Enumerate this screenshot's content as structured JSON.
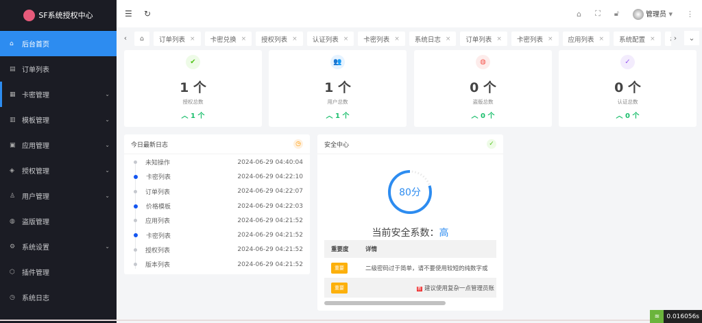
{
  "app": {
    "title": "SF系统授权中心"
  },
  "sidebar": {
    "items": [
      {
        "label": "后台首页",
        "icon": "home-icon",
        "glyph": "⌂",
        "active": true
      },
      {
        "label": "订单列表",
        "icon": "document-icon",
        "glyph": "▤"
      },
      {
        "label": "卡密管理",
        "icon": "grid-icon",
        "glyph": "▦",
        "expandable": true,
        "open": true
      },
      {
        "label": "模板管理",
        "icon": "template-icon",
        "glyph": "▥",
        "expandable": true
      },
      {
        "label": "应用管理",
        "icon": "app-icon",
        "glyph": "▣",
        "expandable": true
      },
      {
        "label": "授权管理",
        "icon": "shield-icon",
        "glyph": "◈",
        "expandable": true
      },
      {
        "label": "用户管理",
        "icon": "user-icon",
        "glyph": "♙",
        "expandable": true
      },
      {
        "label": "盗版管理",
        "icon": "globe-icon",
        "glyph": "◍"
      },
      {
        "label": "系统设置",
        "icon": "gear-icon",
        "glyph": "⚙",
        "expandable": true
      },
      {
        "label": "插件管理",
        "icon": "plugin-icon",
        "glyph": "⬡"
      },
      {
        "label": "系统日志",
        "icon": "clock-icon",
        "glyph": "◷"
      }
    ]
  },
  "header": {
    "user": "管理员"
  },
  "tabs": [
    "订单列表",
    "卡密兑换",
    "授权列表",
    "认证列表",
    "卡密列表",
    "系统日志",
    "订单列表",
    "卡密列表",
    "应用列表",
    "系统配置",
    "模板"
  ],
  "stats": [
    {
      "value": "1 个",
      "label": "授权总数",
      "increase": "1 个",
      "icon": "shield-check-icon",
      "color": "#52c41a",
      "bg": "#eefbe7",
      "glyph": "✔"
    },
    {
      "value": "1 个",
      "label": "用户总数",
      "increase": "1 个",
      "icon": "users-icon",
      "color": "#2d8cf0",
      "bg": "#e6f3ff",
      "glyph": "👥"
    },
    {
      "value": "0 个",
      "label": "盗版总数",
      "increase": "0 个",
      "icon": "globe-icon",
      "color": "#f5564e",
      "bg": "#fdeceb",
      "glyph": "◍"
    },
    {
      "value": "0 个",
      "label": "认证总数",
      "increase": "0 个",
      "icon": "check-circle-icon",
      "color": "#9a5cf0",
      "bg": "#f3ecfd",
      "glyph": "✓"
    }
  ],
  "logs": {
    "title": "今日最新日志",
    "items": [
      {
        "name": "未知操作",
        "time": "2024-06-29 04:40:04",
        "highlight": false
      },
      {
        "name": "卡密列表",
        "time": "2024-06-29 04:22:10",
        "highlight": true
      },
      {
        "name": "订单列表",
        "time": "2024-06-29 04:22:07",
        "highlight": false
      },
      {
        "name": "价格模板",
        "time": "2024-06-29 04:22:03",
        "highlight": true
      },
      {
        "name": "应用列表",
        "time": "2024-06-29 04:21:52",
        "highlight": false
      },
      {
        "name": "卡密列表",
        "time": "2024-06-29 04:21:52",
        "highlight": true
      },
      {
        "name": "授权列表",
        "time": "2024-06-29 04:21:52",
        "highlight": false
      },
      {
        "name": "版本列表",
        "time": "2024-06-29 04:21:52",
        "highlight": false
      }
    ]
  },
  "security": {
    "title": "安全中心",
    "score": "80分",
    "score_value": 80,
    "factor_label": "当前安全系数：",
    "factor_value": "高",
    "table": {
      "headers": [
        "重要度",
        "详情"
      ],
      "rows": [
        {
          "level": "重要",
          "detail": "二级密码过于简单，请不要使用较短的纯数字或",
          "new": ""
        },
        {
          "level": "重要",
          "detail": "建议使用复杂一点管理员账",
          "new": "新"
        }
      ]
    }
  },
  "footer": {
    "timer": "0.016056s"
  }
}
